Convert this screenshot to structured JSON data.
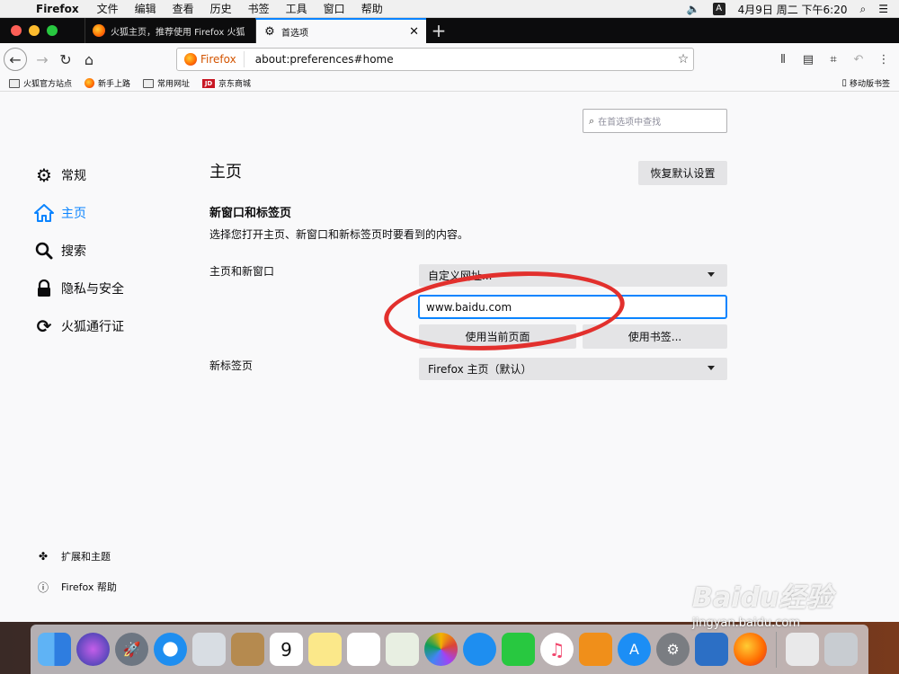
{
  "menubar": {
    "app": "Firefox",
    "items": [
      "文件",
      "编辑",
      "查看",
      "历史",
      "书签",
      "工具",
      "窗口",
      "帮助"
    ],
    "input_method": "A",
    "datetime": "4月9日 周二 下午6:20"
  },
  "tabs": [
    {
      "title": "火狐主页，推荐使用 Firefox 火狐",
      "active": false
    },
    {
      "title": "首选项",
      "active": true
    }
  ],
  "urlbar": {
    "identity": "Firefox",
    "url": "about:preferences#home"
  },
  "bookmarks": {
    "items": [
      "火狐官方站点",
      "新手上路",
      "常用网址",
      "京东商城"
    ],
    "jd_logo": "JD",
    "mobile": "移动版书签"
  },
  "preferences": {
    "search_placeholder": "在首选项中查找",
    "nav": [
      "常规",
      "主页",
      "搜索",
      "隐私与安全",
      "火狐通行证"
    ],
    "footer": [
      "扩展和主题",
      "Firefox 帮助"
    ],
    "page_title": "主页",
    "restore_button": "恢复默认设置",
    "section_title": "新窗口和标签页",
    "section_desc": "选择您打开主页、新窗口和新标签页时要看到的内容。",
    "homepage_label": "主页和新窗口",
    "homepage_select": "自定义网址...",
    "homepage_url": "www.baidu.com",
    "use_current_button": "使用当前页面",
    "use_bookmark_button": "使用书签...",
    "newtab_label": "新标签页",
    "newtab_select": "Firefox 主页（默认）"
  },
  "watermark": {
    "brand": "Baidu经验",
    "domain": "jingyan.baidu.com"
  },
  "colors": {
    "accent": "#0a84ff",
    "annotation": "#e2302d",
    "tabbar": "#0c0c0d"
  }
}
